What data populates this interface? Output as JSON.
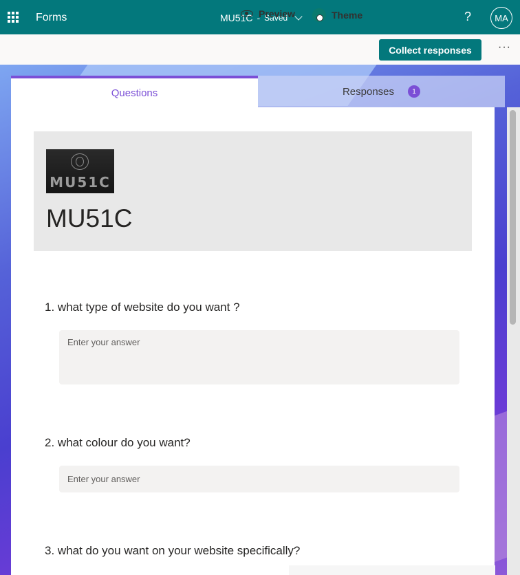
{
  "app": {
    "name": "Forms",
    "doc_title": "MU51C",
    "separator": "-",
    "status": "Saved",
    "help_glyph": "?",
    "avatar_initials": "MA"
  },
  "toolbar": {
    "preview_label": "Preview",
    "theme_label": "Theme",
    "collect_label": "Collect responses",
    "more_glyph": "···"
  },
  "tabs": {
    "questions_label": "Questions",
    "responses_label": "Responses",
    "responses_count": "1"
  },
  "form": {
    "logo_text": "MU51C",
    "title": "MU51C",
    "questions": [
      {
        "number": "1.",
        "text": "what type of website do you want ?",
        "placeholder": "Enter your answer"
      },
      {
        "number": "2.",
        "text": "what colour do you want?",
        "placeholder": "Enter your answer"
      },
      {
        "number": "3.",
        "text": "what do you want on your website specifically?"
      }
    ]
  },
  "colors": {
    "brand": "#03787c",
    "accent": "#7b4fd6"
  }
}
